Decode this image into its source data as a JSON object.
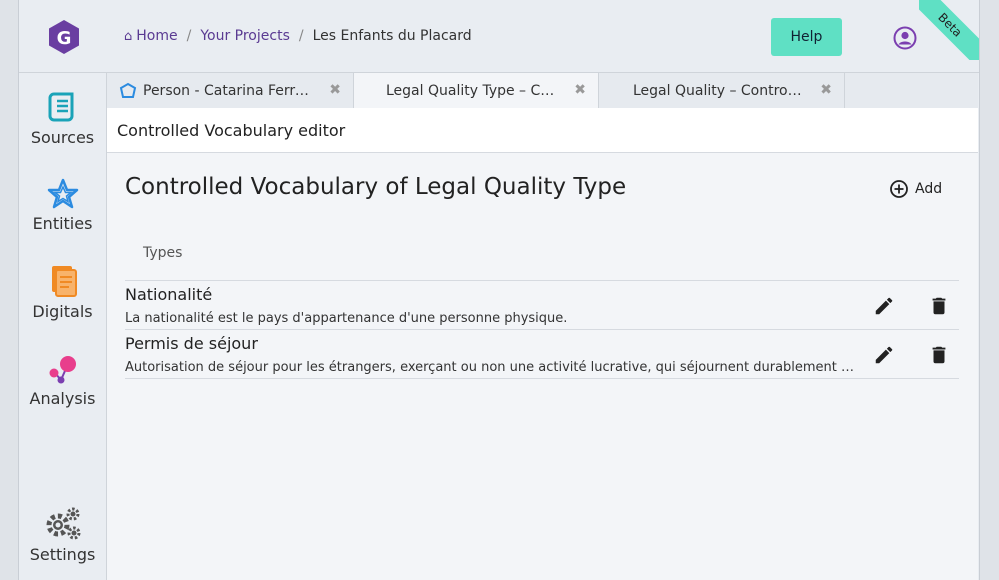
{
  "header": {
    "breadcrumb": [
      {
        "label": "Home"
      },
      {
        "label": "Your Projects"
      },
      {
        "label": "Les Enfants du Placard"
      }
    ],
    "help_label": "Help",
    "beta_label": "Beta"
  },
  "sidebar": {
    "items": [
      {
        "label": "Sources",
        "icon": "sources-icon",
        "color": "#1aa3b8"
      },
      {
        "label": "Entities",
        "icon": "entities-icon",
        "color": "#2b8be0"
      },
      {
        "label": "Digitals",
        "icon": "digitals-icon",
        "color": "#f08a24"
      },
      {
        "label": "Analysis",
        "icon": "analysis-icon",
        "color": "#e83e8c"
      },
      {
        "label": "Settings",
        "icon": "settings-icon",
        "color": "#555555"
      }
    ]
  },
  "tabs": [
    {
      "label": "Person - Catarina Ferreira",
      "active": false
    },
    {
      "label": "Legal Quality Type – Controlled Vocabulary",
      "active": true
    },
    {
      "label": "Legal Quality – Controlled Vocabulary",
      "active": false
    }
  ],
  "panel": {
    "title": "Controlled Vocabulary editor",
    "heading": "Controlled Vocabulary of Legal Quality Type",
    "add_label": "Add",
    "column_header": "Types",
    "rows": [
      {
        "name": "Nationalité",
        "description": "La nationalité est le pays d'appartenance d'une personne physique."
      },
      {
        "name": "Permis de séjour",
        "description": "Autorisation de séjour pour les étrangers, exerçant ou non une activité lucrative, qui séjournent durablement en Suisse."
      }
    ]
  },
  "colors": {
    "accent": "#5fe0c4",
    "brand": "#6a3ea1",
    "link": "#5a3a92"
  }
}
